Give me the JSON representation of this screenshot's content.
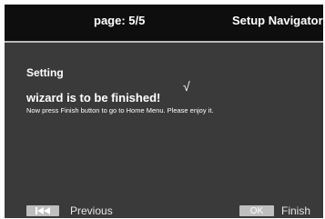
{
  "header": {
    "page_label": "page: 5/5",
    "title": "Setup Navigator"
  },
  "content": {
    "section_title": "Setting",
    "check_glyph": "√",
    "heading": "wizard is to be finished!",
    "message": "Now press Finish button to go to Home Menu. Please enjoy it."
  },
  "footer": {
    "previous": {
      "key_icon": "skip-back-icon",
      "label": "Previous"
    },
    "finish": {
      "key_text": "OK",
      "label": "Finish"
    }
  },
  "colors": {
    "header_bg": "#0e0e0e",
    "content_bg": "#3a3a3a",
    "key_bg": "#bfbfbf",
    "divider": "#b8b8b8"
  }
}
